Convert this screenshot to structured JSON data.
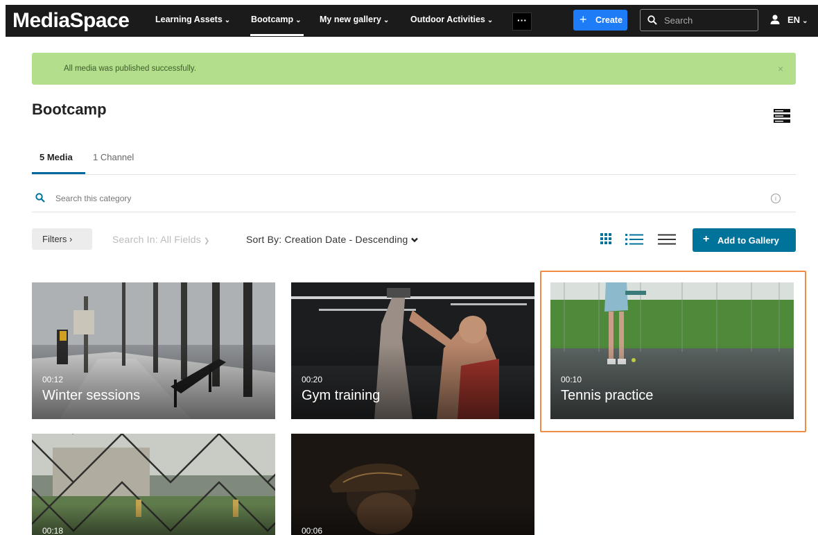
{
  "header": {
    "logo": "MediaSpace",
    "nav": [
      {
        "label": "Learning Assets"
      },
      {
        "label": "Bootcamp"
      },
      {
        "label": "My new gallery"
      },
      {
        "label": "Outdoor Activities"
      }
    ],
    "more_label": "···",
    "create_label": "Create",
    "search_placeholder": "Search",
    "language": "EN"
  },
  "alert": {
    "message": "All media was published successfully.",
    "close": "×"
  },
  "page": {
    "title": "Bootcamp"
  },
  "tabs": [
    {
      "label": "5 Media"
    },
    {
      "label": "1 Channel"
    }
  ],
  "category_search": {
    "placeholder": "Search this category"
  },
  "toolbar": {
    "filters_label": "Filters ›",
    "search_in_label": "Search In: All Fields",
    "sort_label": "Sort By: Creation Date - Descending",
    "add_to_gallery_label": "Add to Gallery"
  },
  "media": [
    {
      "title": "Winter sessions",
      "duration": "00:12"
    },
    {
      "title": "Gym training",
      "duration": "00:20"
    },
    {
      "title": "Tennis practice",
      "duration": "00:10"
    },
    {
      "title": "",
      "duration": "00:18"
    },
    {
      "title": "",
      "duration": "00:06"
    }
  ],
  "colors": {
    "nav_bg": "#1b1b1b",
    "create_button": "#1f7cf7",
    "alert_bg": "#b3df8d",
    "accent": "#00739b",
    "highlight_border": "#f08a45"
  }
}
